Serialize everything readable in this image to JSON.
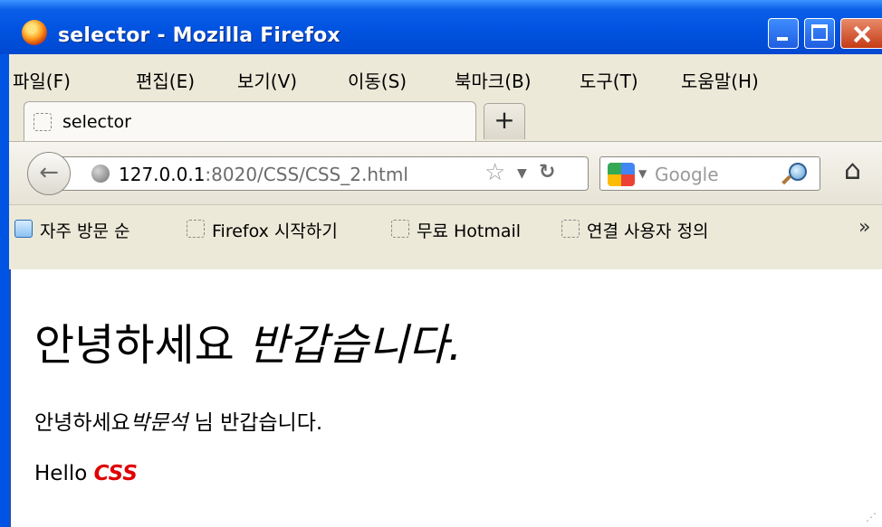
{
  "window": {
    "title": "selector - Mozilla Firefox"
  },
  "menu": [
    "파일(F)",
    "편집(E)",
    "보기(V)",
    "이동(S)",
    "북마크(B)",
    "도구(T)",
    "도움말(H)"
  ],
  "tabs": [
    {
      "label": "selector"
    }
  ],
  "newtab_label": "+",
  "nav": {
    "url_host": "127.0.0.1",
    "url_rest": ":8020/CSS/CSS_2.html",
    "search_placeholder": "Google"
  },
  "bookmarks": [
    "자주 방문 순",
    "Firefox 시작하기",
    "무료 Hotmail",
    "연결 사용자 정의"
  ],
  "bookmarks_more": "»",
  "page": {
    "heading_plain": "안녕하세요",
    "heading_em": "반갑습니다.",
    "p1_before": "안녕하세요",
    "p1_em": "박문석",
    "p1_after": " 님 반갑습니다.",
    "p2_before": "Hello ",
    "p2_css": "CSS"
  },
  "colors": {
    "titlebar": "#0054e3",
    "css_text": "#e00000",
    "chrome_bg": "#ece9d8"
  }
}
